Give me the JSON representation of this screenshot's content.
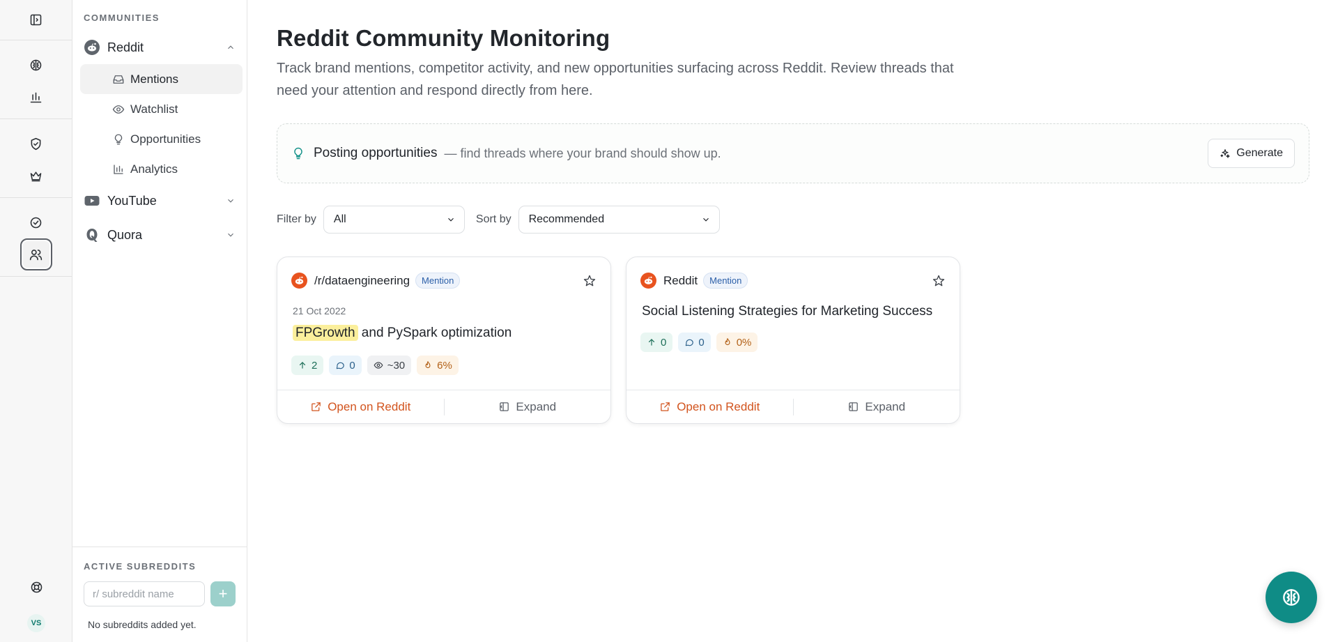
{
  "rail": {
    "icons": [
      "sidebar-toggle-icon",
      "brain-icon",
      "bar-chart-icon",
      "shield-check-icon",
      "crown-icon",
      "check-circle-icon",
      "users-icon",
      "lifebuoy-icon"
    ],
    "avatar_initials": "VS"
  },
  "sidebar": {
    "section_label": "COMMUNITIES",
    "communities": [
      {
        "name": "Reddit",
        "expanded": true,
        "items": [
          {
            "label": "Mentions",
            "icon": "inbox-icon",
            "active": true
          },
          {
            "label": "Watchlist",
            "icon": "eye-icon"
          },
          {
            "label": "Opportunities",
            "icon": "lightbulb-icon"
          },
          {
            "label": "Analytics",
            "icon": "bar-chart-icon"
          }
        ]
      },
      {
        "name": "YouTube",
        "expanded": false
      },
      {
        "name": "Quora",
        "expanded": false
      }
    ],
    "active_subreddits": {
      "label": "ACTIVE SUBREDDITS",
      "placeholder": "r/ subreddit name",
      "add_label": "+",
      "empty_text": "No subreddits added yet."
    }
  },
  "main": {
    "title": "Reddit Community Monitoring",
    "description": "Track brand mentions, competitor activity, and new opportunities surfacing across Reddit. Review threads that need your attention and respond directly from here.",
    "opportunities": {
      "title": "Posting opportunities",
      "subtitle": "— find threads where your brand should show up.",
      "button": "Generate"
    },
    "filters": {
      "filter_label": "Filter by",
      "filter_value": "All",
      "sort_label": "Sort by",
      "sort_value": "Recommended"
    },
    "cards": [
      {
        "source": "/r/dataengineering",
        "badge": "Mention",
        "date": "21 Oct 2022",
        "title_highlight": "FPGrowth",
        "title_rest": " and PySpark optimization",
        "upvotes": "2",
        "comments": "0",
        "views": "~30",
        "heat": "6%",
        "open_label": "Open on Reddit",
        "expand_label": "Expand"
      },
      {
        "source": "Reddit",
        "badge": "Mention",
        "title": "Social Listening Strategies for Marketing Success",
        "upvotes": "0",
        "comments": "0",
        "heat": "0%",
        "open_label": "Open on Reddit",
        "expand_label": "Expand"
      }
    ]
  },
  "colors": {
    "accent": "#0f8c86",
    "reddit": "#e8531f",
    "highlight": "#fbef9c"
  }
}
